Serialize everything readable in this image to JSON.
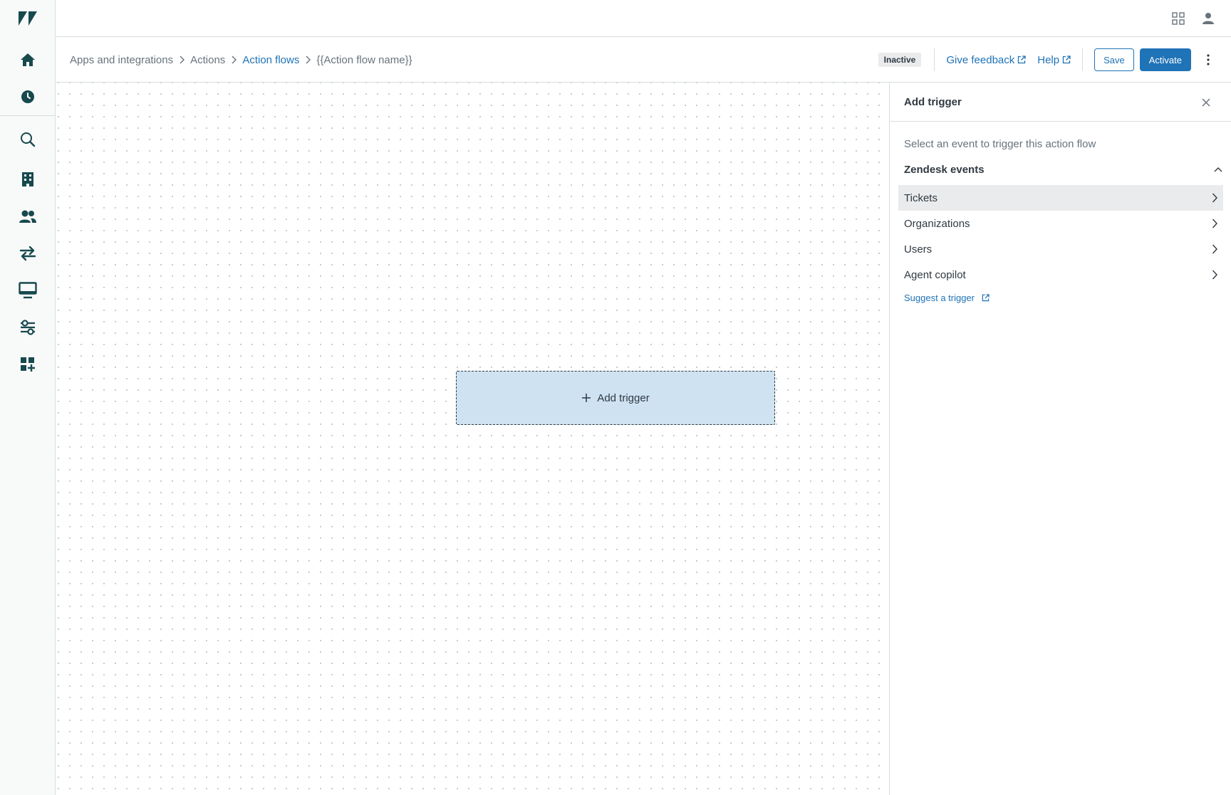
{
  "nav": {
    "items": [
      {
        "name": "zendesk-logo-icon"
      },
      {
        "name": "home-icon"
      },
      {
        "name": "clock-icon"
      },
      {
        "name": "search-icon"
      },
      {
        "name": "building-icon"
      },
      {
        "name": "people-icon"
      },
      {
        "name": "transfer-arrows-icon"
      },
      {
        "name": "monitor-icon"
      },
      {
        "name": "sliders-icon"
      },
      {
        "name": "apps-add-icon"
      }
    ]
  },
  "topbar": {
    "icons": [
      "grid-icon",
      "user-icon"
    ]
  },
  "breadcrumb": {
    "items": [
      "Apps and integrations",
      "Actions",
      "Action flows",
      "{{Action flow name}}"
    ]
  },
  "header_actions": {
    "status": "Inactive",
    "feedback": "Give feedback",
    "help": "Help",
    "save": "Save",
    "activate": "Activate"
  },
  "canvas": {
    "add_trigger": "Add trigger"
  },
  "panel": {
    "title": "Add trigger",
    "hint": "Select an event to trigger this action flow",
    "section": "Zendesk events",
    "events": [
      "Tickets",
      "Organizations",
      "Users",
      "Agent copilot"
    ],
    "suggest": "Suggest a trigger"
  },
  "colors": {
    "accent": "#1f73b7",
    "nav_icon": "#17494d",
    "trigger_box": "#cee2f2"
  }
}
